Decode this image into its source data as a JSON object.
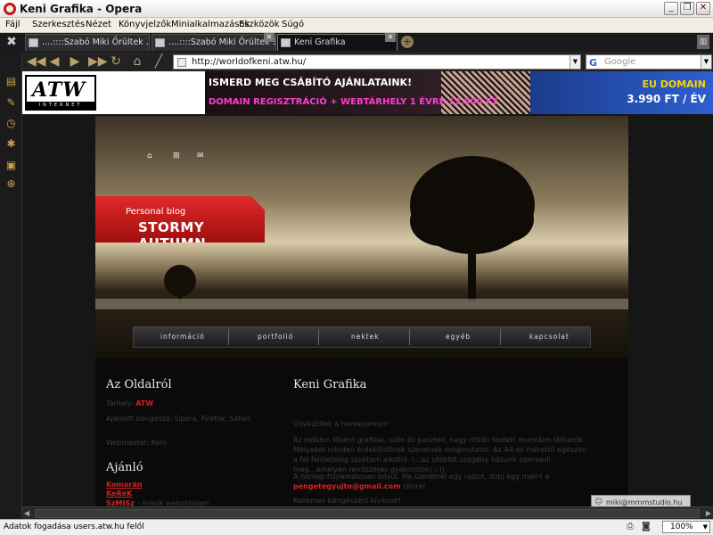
{
  "window": {
    "title": "Keni Grafika - Opera"
  },
  "menu": [
    "Fájl",
    "Szerkesztés",
    "Nézet",
    "Könyvjelzők",
    "Minialkalmazások",
    "Eszközök",
    "Súgó"
  ],
  "tabs": [
    {
      "label": "....::::Szabó Miki Őrültek ...",
      "active": false
    },
    {
      "label": "....::::Szabó Miki Őrültek S...",
      "active": false
    },
    {
      "label": "Keni Grafika",
      "active": true
    }
  ],
  "address": {
    "url": "http://worldofkeni.atw.hu/",
    "search_placeholder": "Google"
  },
  "ads": {
    "logo": "ATW",
    "logo_sub": "INTERNET",
    "banner_line1": "ISMERD MEG CSÁBÍTÓ AJÁNLATAINK!",
    "banner_line2": "DOMAIN REGISZTRÁCIÓ + WEBTÁRHELY 1 ÉVRE 13.900 FT",
    "eu_line1": "EU DOMAIN",
    "eu_line2": "3.990 FT / ÉV"
  },
  "header": {
    "blog_label": "Personal blog",
    "blog_title": "STORMY AUTUMN"
  },
  "nav": [
    "információ",
    "portfolió",
    "nektek",
    "egyéb",
    "kapcsolat"
  ],
  "sidebar": {
    "about_title": "Az Oldalról",
    "host_label": "Tárhely:",
    "host_value": "ATW",
    "browsers": "Ajánlott böngésző: Opera, Firefox, Safari",
    "webmaster": "Webmester: Keni",
    "recommend_title": "Ajánló",
    "links": [
      "Komorán",
      "KeReK",
      "SzMISz"
    ],
    "links_suffix": "- másik weboldalam"
  },
  "main": {
    "title": "Keni Grafika",
    "welcome": "Üdvözöllek a honlapomon!",
    "para1": "Az oldalon főként grafikai, szén és pasztell, nagy ritkán festett munkáim láthatók. Melyeket minden érdeklődőnek szeretnék megmutatni. Az A4-es mérettő egészen a fal felületekig szoktam alkotni. (...az utóbbit szegény házunk szenvedi meg...amelyen rendszeres gyakorolok) :-))",
    "para2": "A honlap folyamatosan bővül. Ha szeretnél egy rajzot, dobj egy mail-t a",
    "email": "pengetegyujto@gmail.com",
    "para2_end": "címre!",
    "closing": "Kellemes böngészést kívánok!"
  },
  "popup": "miki@mmmstudio.hu",
  "status": {
    "text": "Adatok fogadása users.atw.hu felől",
    "zoom": "100%"
  }
}
